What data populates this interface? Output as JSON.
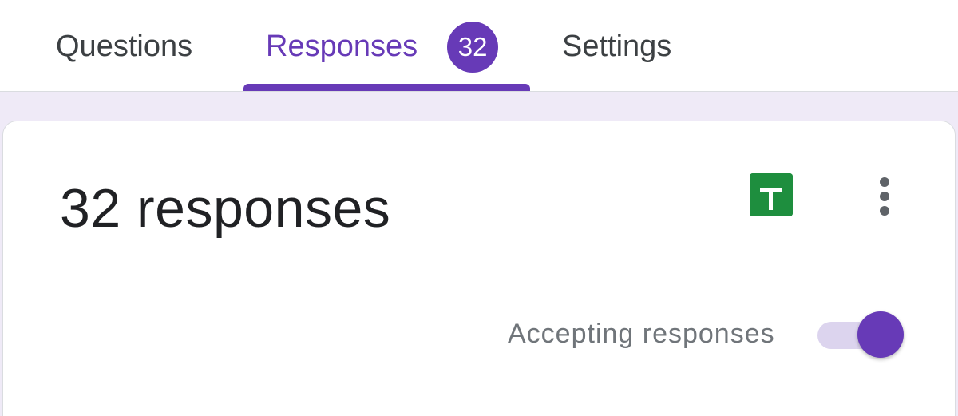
{
  "tabs": {
    "questions_label": "Questions",
    "responses_label": "Responses",
    "responses_count": "32",
    "settings_label": "Settings",
    "active_tab": "Responses",
    "accent_color": "#673ab7"
  },
  "summary": {
    "title": "32 responses",
    "spreadsheet_icon": "spreadsheet-icon",
    "more_icon": "more-vert-icon",
    "accepting_label": "Accepting responses",
    "accepting_enabled": true
  }
}
